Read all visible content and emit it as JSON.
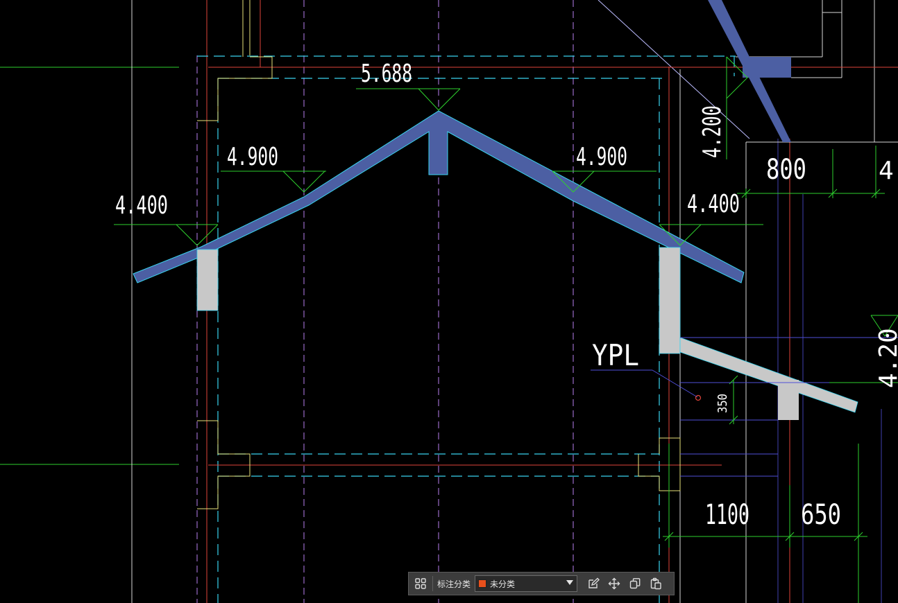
{
  "drawing": {
    "elevations": {
      "ridge": "5.688",
      "left_mid": "4.900",
      "right_mid": "4.900",
      "left_eave": "4.400",
      "right_eave": "4.400",
      "upper_right": "4.200",
      "right_edge_partial": "4",
      "right_edge_rotated": "4.20"
    },
    "dimensions": {
      "top_800": "800",
      "bottom_1100": "1100",
      "bottom_650": "650",
      "canopy_350": "350"
    },
    "labels": {
      "ypl": "YPL"
    },
    "colors": {
      "roof_fill": "#4c5fa3",
      "roof_edge": "#39d4ef",
      "wall_fill": "#c8c8c8",
      "axis_dash": "#b77ff0",
      "red_line": "#e0443a",
      "cyan_line": "#39d4ef",
      "green_line": "#2ed12e",
      "yellow_line": "#e8e27a"
    }
  },
  "toolbar": {
    "grid_icon": "grid-icon",
    "category_label": "标注分类",
    "category_value": "未分类",
    "category_swatch": "#e8501c",
    "edit_icon": "edit-icon",
    "move_icon": "move-icon",
    "copy_icon": "copy-icon",
    "paste_icon": "paste-icon"
  }
}
